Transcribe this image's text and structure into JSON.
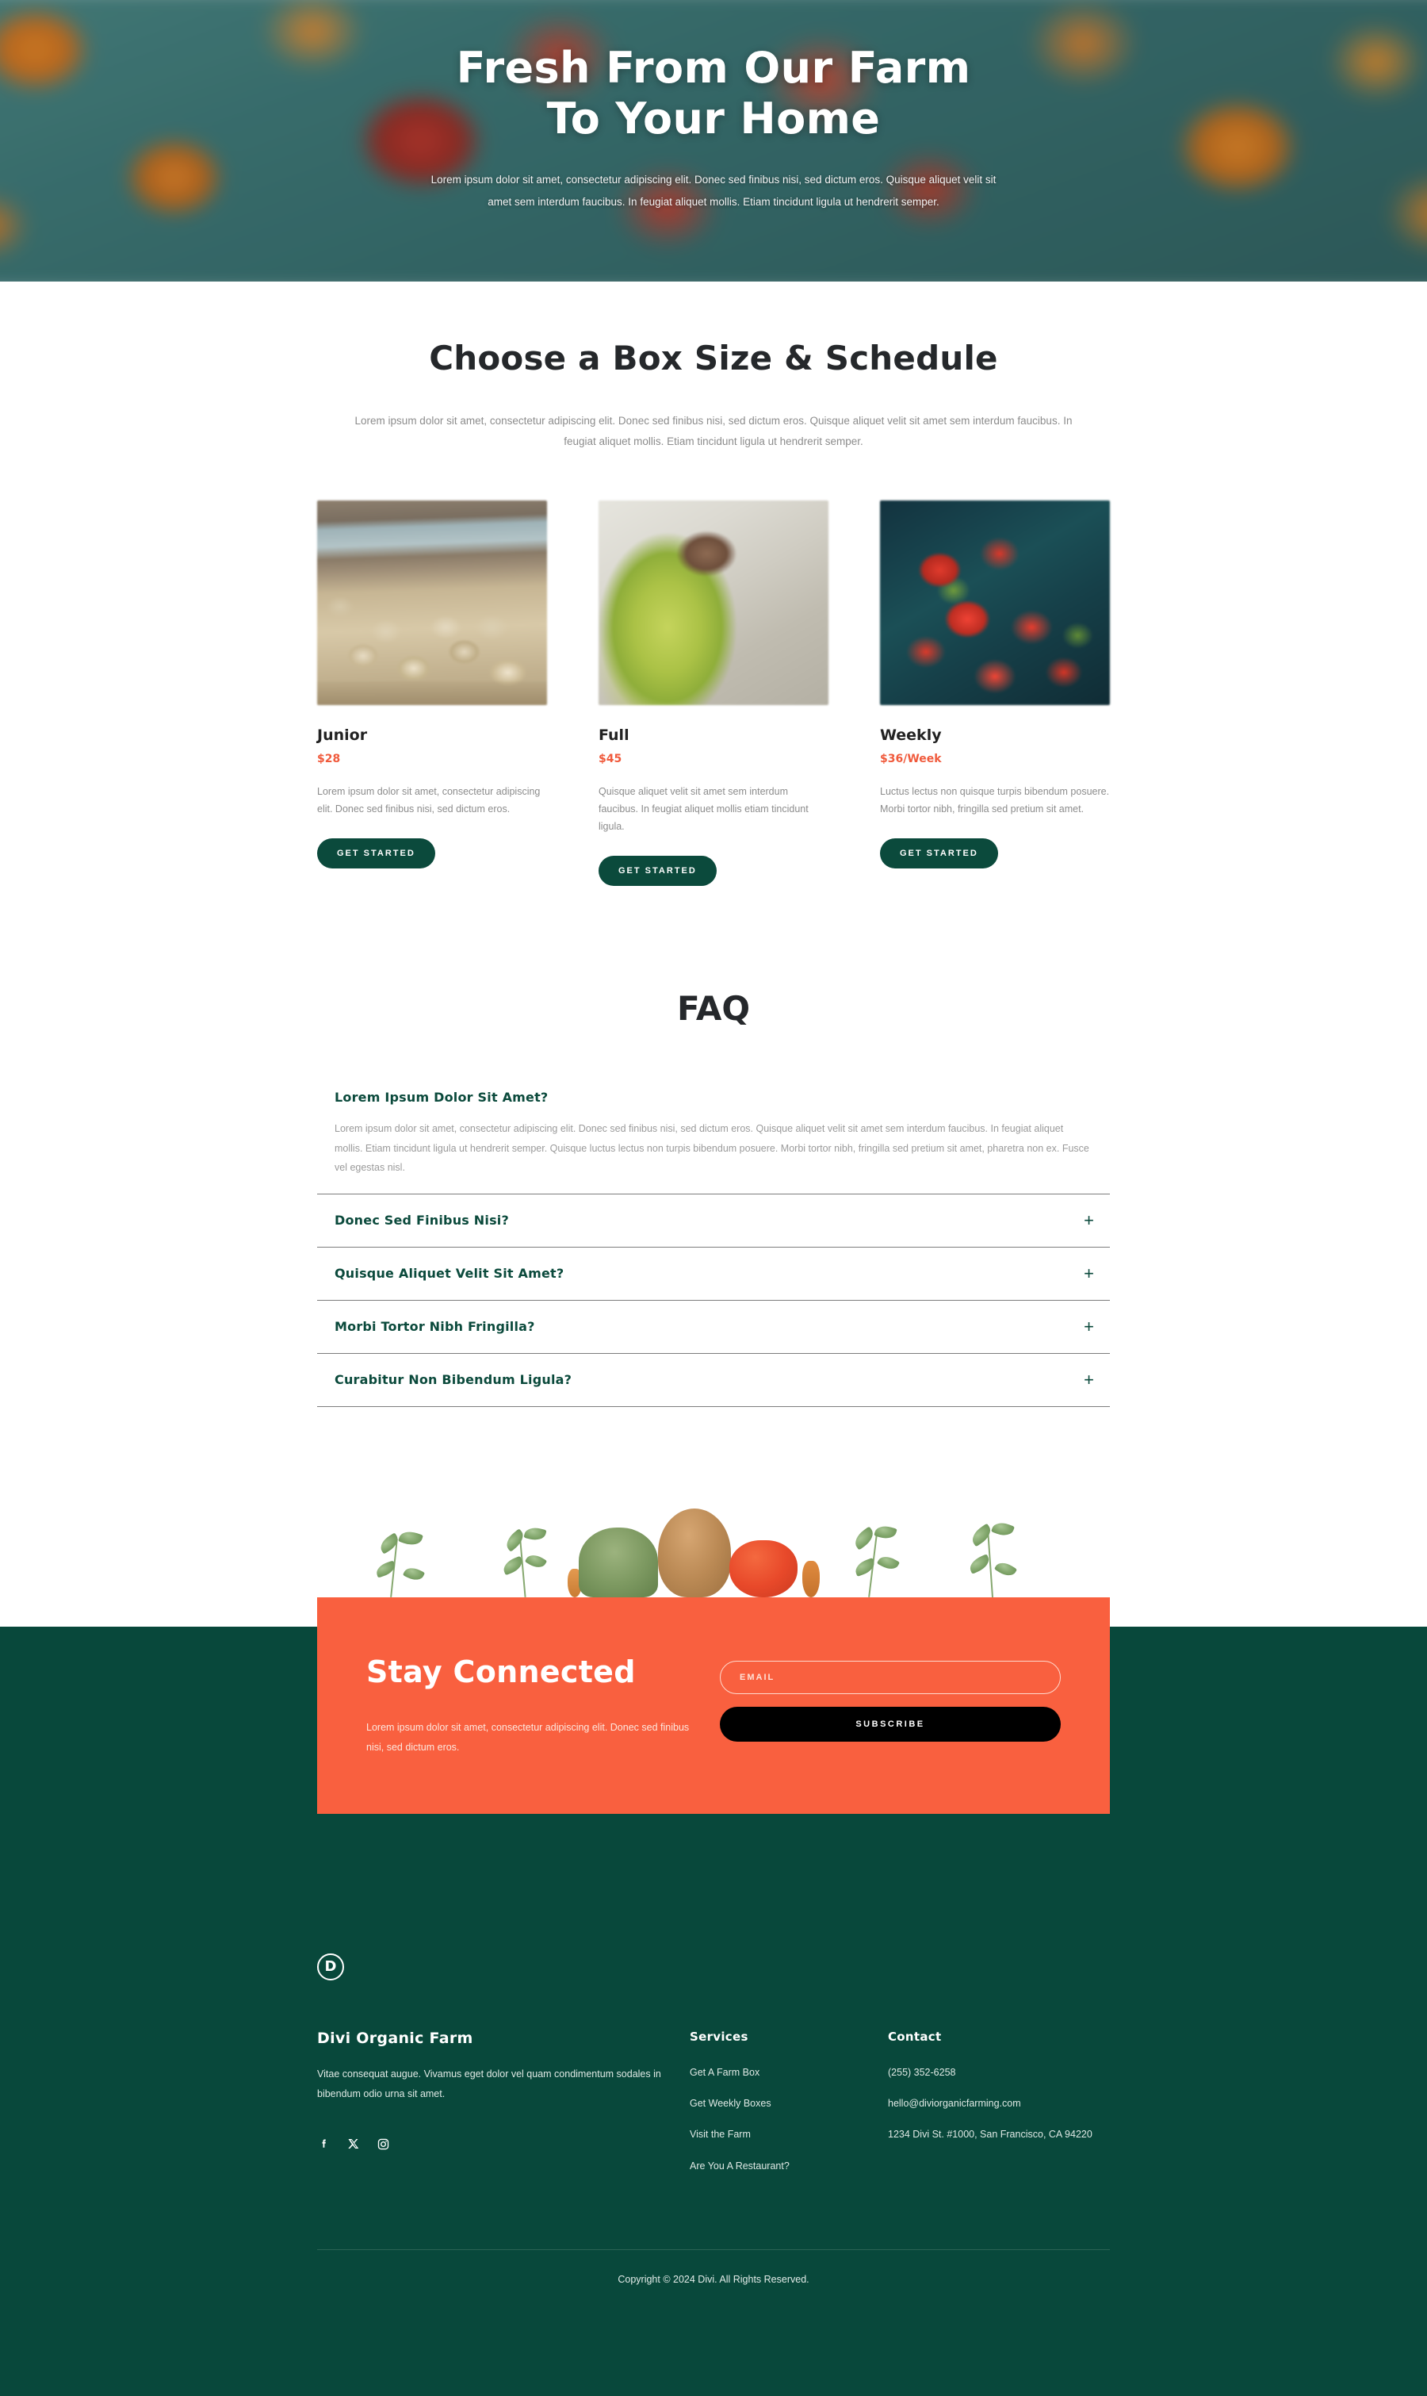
{
  "hero": {
    "title_line1": "Fresh From Our Farm",
    "title_line2": "To Your Home",
    "subtitle": "Lorem ipsum dolor sit amet, consectetur adipiscing elit. Donec sed finibus nisi, sed dictum eros. Quisque aliquet velit sit amet sem interdum faucibus. In feugiat aliquet mollis. Etiam tincidunt ligula ut hendrerit semper."
  },
  "boxes": {
    "title": "Choose a Box Size & Schedule",
    "subtitle": "Lorem ipsum dolor sit amet, consectetur adipiscing elit. Donec sed finibus nisi, sed dictum eros. Quisque aliquet velit sit amet sem interdum faucibus. In feugiat aliquet mollis. Etiam tincidunt ligula ut hendrerit semper.",
    "cards": [
      {
        "image": "potatoes-in-crates-photo",
        "name": "Junior",
        "price": "$28",
        "description": "Lorem ipsum dolor sit amet, consectetur adipiscing elit. Donec sed finibus nisi, sed dictum eros.",
        "cta": "GET STARTED"
      },
      {
        "image": "broccoli-greens-market-photo",
        "name": "Full",
        "price": "$45",
        "description": "Quisque aliquet velit sit amet sem interdum faucibus. In feugiat aliquet mollis etiam tincidunt ligula.",
        "cta": "GET STARTED"
      },
      {
        "image": "red-peppers-tomatoes-crate-photo",
        "name": "Weekly",
        "price": "$36/Week",
        "description": "Luctus lectus non quisque turpis bibendum posuere. Morbi tortor nibh, fringilla sed pretium sit amet.",
        "cta": "GET STARTED"
      }
    ]
  },
  "faq": {
    "title": "FAQ",
    "items": [
      {
        "question": "Lorem Ipsum Dolor Sit Amet?",
        "answer": "Lorem ipsum dolor sit amet, consectetur adipiscing elit. Donec sed finibus nisi, sed dictum eros. Quisque aliquet velit sit amet sem interdum faucibus. In feugiat aliquet mollis. Etiam tincidunt ligula ut hendrerit semper. Quisque luctus lectus non turpis bibendum posuere. Morbi tortor nibh, fringilla sed pretium sit amet, pharetra non ex. Fusce vel egestas nisl.",
        "open": true,
        "toggle": ""
      },
      {
        "question": "Donec Sed Finibus Nisi?",
        "answer": "",
        "open": false,
        "toggle": "+"
      },
      {
        "question": "Quisque Aliquet Velit Sit Amet?",
        "answer": "",
        "open": false,
        "toggle": "+"
      },
      {
        "question": "Morbi Tortor Nibh Fringilla?",
        "answer": "",
        "open": false,
        "toggle": "+"
      },
      {
        "question": "Curabitur Non Bibendum Ligula?",
        "answer": "",
        "open": false,
        "toggle": "+"
      }
    ]
  },
  "newsletter": {
    "title": "Stay Connected",
    "description": "Lorem ipsum dolor sit amet, consectetur adipiscing elit. Donec sed finibus nisi, sed dictum eros.",
    "email_placeholder": "EMAIL",
    "email_value": "",
    "subscribe_label": "SUBSCRIBE",
    "accent_color": "#f9603f",
    "button_color": "#000000"
  },
  "footer": {
    "logo": "divi-d-logo",
    "brand_title": "Divi Organic Farm",
    "brand_text": "Vitae consequat augue. Vivamus eget dolor vel quam condimentum sodales in bibendum odio urna sit amet.",
    "socials": [
      "facebook-icon",
      "x-twitter-icon",
      "instagram-icon"
    ],
    "services_title": "Services",
    "services": [
      "Get A Farm Box",
      "Get Weekly Boxes",
      "Visit the Farm",
      "Are You A Restaurant?"
    ],
    "contact_title": "Contact",
    "contact": [
      "(255) 352-6258",
      "hello@diviorganicfarming.com",
      "1234 Divi St. #1000, San Francisco, CA 94220"
    ],
    "copyright": "Copyright © 2024 Divi. All Rights Reserved.",
    "background_color": "#08483b"
  },
  "theme": {
    "green": "#0b4a3c",
    "orange": "#f9603f",
    "price_color": "#f05a3c"
  }
}
